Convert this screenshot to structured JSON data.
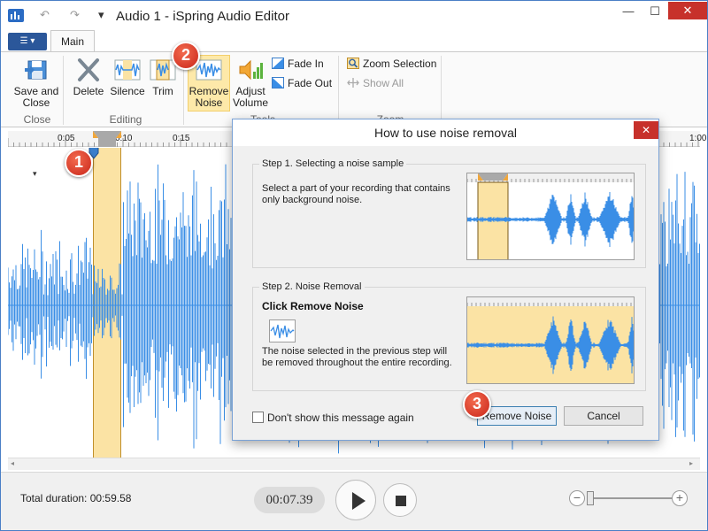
{
  "window": {
    "title": "Audio 1 - iSpring Audio Editor"
  },
  "quick_access": {
    "undo": "↶",
    "redo": "↷",
    "customize": "▾"
  },
  "window_controls": {
    "minimize": "—",
    "maximize": "☐",
    "close": "✕"
  },
  "ribbon": {
    "menu_button": "☰ ▾",
    "tabs": [
      {
        "label": "Main"
      }
    ],
    "groups": {
      "close": {
        "label": "Close",
        "buttons": {
          "save_close": "Save and\nClose"
        }
      },
      "editing": {
        "label": "Editing",
        "buttons": {
          "delete": "Delete",
          "silence": "Silence",
          "trim": "Trim"
        }
      },
      "tools": {
        "label": "Tools",
        "buttons": {
          "remove_noise": "Remove\nNoise",
          "adjust_volume": "Adjust\nVolume",
          "fade_in": "Fade In",
          "fade_out": "Fade Out"
        }
      },
      "zoom": {
        "label": "Zoom",
        "buttons": {
          "zoom_selection": "Zoom Selection",
          "show_all": "Show All"
        }
      }
    }
  },
  "timeline": {
    "ticks": [
      "0:05",
      "0:10",
      "0:15",
      "1:00"
    ]
  },
  "callouts": [
    "1",
    "2",
    "3"
  ],
  "footer": {
    "total_duration_label": "Total duration:",
    "total_duration_value": "00:59.58",
    "current_time": "00:07.39",
    "zoom_minus": "−",
    "zoom_plus": "+"
  },
  "dialog": {
    "title": "How to use noise removal",
    "close": "✕",
    "step1": {
      "title": "Step 1. Selecting a noise sample",
      "text": "Select a part of your recording that contains only background noise."
    },
    "step2": {
      "title": "Step 2. Noise Removal",
      "heading": "Click Remove Noise",
      "text": "The noise selected in the previous step will be removed throughout the entire recording."
    },
    "dont_show": "Don't show this message again",
    "buttons": {
      "remove_noise": "Remove Noise",
      "cancel": "Cancel"
    }
  },
  "colors": {
    "waveform": "#3a8ee6",
    "selection": "#fbe3a4",
    "accent": "#2b579a",
    "callout": "#d8331f",
    "close": "#c7312b"
  },
  "icons": [
    "app-icon",
    "save-close-icon",
    "delete-icon",
    "silence-icon",
    "trim-icon",
    "remove-noise-icon",
    "adjust-volume-icon",
    "fade-in-icon",
    "fade-out-icon",
    "zoom-selection-icon",
    "show-all-icon",
    "play-icon",
    "stop-icon"
  ]
}
